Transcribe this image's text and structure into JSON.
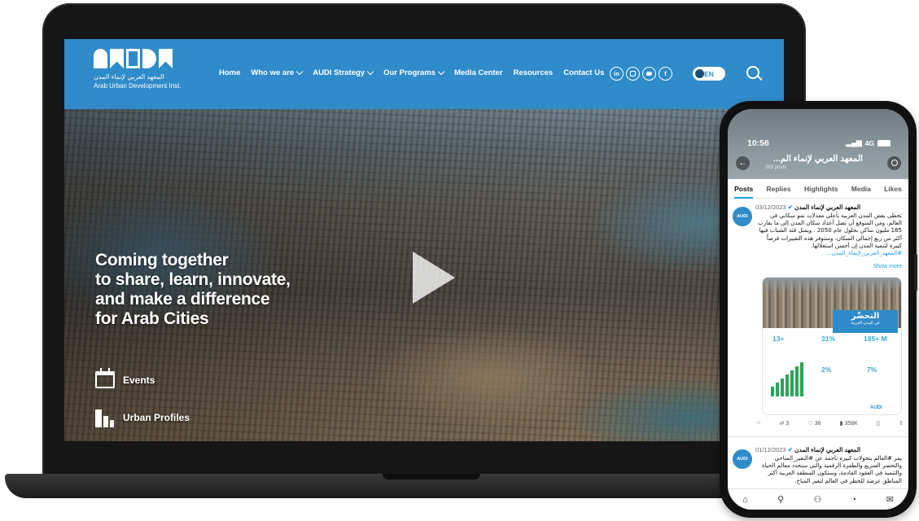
{
  "website": {
    "logo": {
      "arabic_name": "المعهد العربي لإنماء المدن",
      "english_name": "Arab Urban Development Inst."
    },
    "nav": [
      {
        "label": "Home",
        "has_dropdown": false
      },
      {
        "label": "Who we are",
        "has_dropdown": true
      },
      {
        "label": "AUDI Strategy",
        "has_dropdown": true
      },
      {
        "label": "Our Programs",
        "has_dropdown": true
      },
      {
        "label": "Media Center",
        "has_dropdown": false
      },
      {
        "label": "Resources",
        "has_dropdown": false
      },
      {
        "label": "Contact Us",
        "has_dropdown": false
      }
    ],
    "socials": [
      "in",
      "ig",
      "tw",
      "f"
    ],
    "language": "EN",
    "hero": {
      "title_lines": [
        "Coming together",
        "to share, learn, innovate,",
        "and make a difference",
        "for Arab Cities"
      ],
      "links": [
        {
          "label": "Events",
          "icon": "calendar-icon"
        },
        {
          "label": "Urban Profiles",
          "icon": "buildings-icon"
        }
      ]
    },
    "colors": {
      "brand_blue": "#2f8bc9"
    }
  },
  "phone": {
    "status": {
      "time": "10:56",
      "network": "4G"
    },
    "profile": {
      "name": "المعهد العربي لإنماء الم...",
      "posts_count": "263 posts"
    },
    "tabs": [
      "Posts",
      "Replies",
      "Highlights",
      "Media",
      "Likes"
    ],
    "posts": [
      {
        "author": "المعهد العربي لإنماء المدن",
        "date": "03/12/2023",
        "text": "تحظى بعض المدن العربية بأعلى معدلات نمو سكاني في العالم، ومن المتوقع أن تصل أعداد سكان المدن إلى ما يقارب 185 مليون ساكن بحلول عام 2050 . ويمثل فئة الشباب فيها أكثر من ربع إجمالي السكان، وستوفر هذه التغييرات فرصاً كبيرة لتنمية المدن إن أحسن استغلالها.",
        "hashtag": "#المعهد_العربي_لإنماء_المدن...",
        "show_more": "Show more",
        "card": {
          "banner_title": "التحضّر",
          "banner_sub": "في المدن العربية",
          "stats": [
            "13+",
            "31%",
            "185+ M",
            "2%",
            "7%"
          ],
          "footer_logo": "AUDI"
        },
        "actions": {
          "replies": "",
          "reposts": "3",
          "likes": "38",
          "views": "358K"
        }
      },
      {
        "author": "المعهد العربي لإنماء المدن",
        "date": "01/12/2023",
        "text": "يمر #العالم بتحولات كبيرة ناجمة عن #التغير_المناخي والتحضر السريع والطفرة الرقمية والتي ستحدد معالم الحياة والتنمية في العقود القادمة، وستكون المنطقة العربية أكثر المناطق عرضة للخطر في العالم لتغير المناخ."
      }
    ],
    "bottom_nav": [
      "home-icon",
      "search-icon",
      "communities-icon",
      "notifications-icon",
      "messages-icon"
    ]
  }
}
